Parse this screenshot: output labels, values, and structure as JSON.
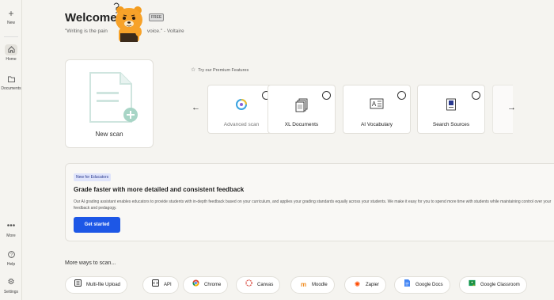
{
  "sidebar": {
    "new_label": "New",
    "home_label": "Home",
    "documents_label": "Documents",
    "more_label": "More",
    "help_label": "Help",
    "settings_label": "Settings"
  },
  "header": {
    "welcome": "Welcome",
    "badge": "FREE",
    "quote": "\"Writing is the pain",
    "quote_end": "voice.\" - Voltaire"
  },
  "new_scan": {
    "label": "New scan"
  },
  "premium": {
    "title": "Try our Premium Features",
    "features": [
      {
        "label": "Advanced scan",
        "icon": "ring-icon"
      },
      {
        "label": "XL Documents",
        "icon": "stacked-docs-icon"
      },
      {
        "label": "AI Vocabulary",
        "icon": "vocab-card-icon"
      },
      {
        "label": "Search Sources",
        "icon": "book-icon"
      }
    ]
  },
  "educators": {
    "badge": "New for Educators",
    "title": "Grade faster with more detailed and consistent feedback",
    "body": "Our AI grading assistant enables educators to provide students with in-depth feedback based on your curriculum, and applies your grading standards equally across your students. We make it easy for you to spend more time with students while maintaining control over your feedback and pedagogy.",
    "button": "Get started"
  },
  "more_ways": {
    "title": "More ways to scan...",
    "chips": [
      {
        "label": "Multi-file Upload",
        "icon": "upload-icon"
      },
      {
        "label": "API",
        "icon": "code-icon"
      },
      {
        "label": "Chrome",
        "icon": "chrome-icon"
      },
      {
        "label": "Canvas",
        "icon": "canvas-icon"
      },
      {
        "label": "Moodle",
        "icon": "moodle-icon"
      },
      {
        "label": "Zapier",
        "icon": "zapier-icon"
      },
      {
        "label": "Google Docs",
        "icon": "google-docs-icon"
      },
      {
        "label": "Google Classroom",
        "icon": "google-classroom-icon"
      }
    ]
  },
  "colors": {
    "accent": "#1d57e6",
    "background": "#f5f4f0",
    "new_scan_doc": "#cfe5df",
    "badge_bg": "#dfe4fb"
  }
}
